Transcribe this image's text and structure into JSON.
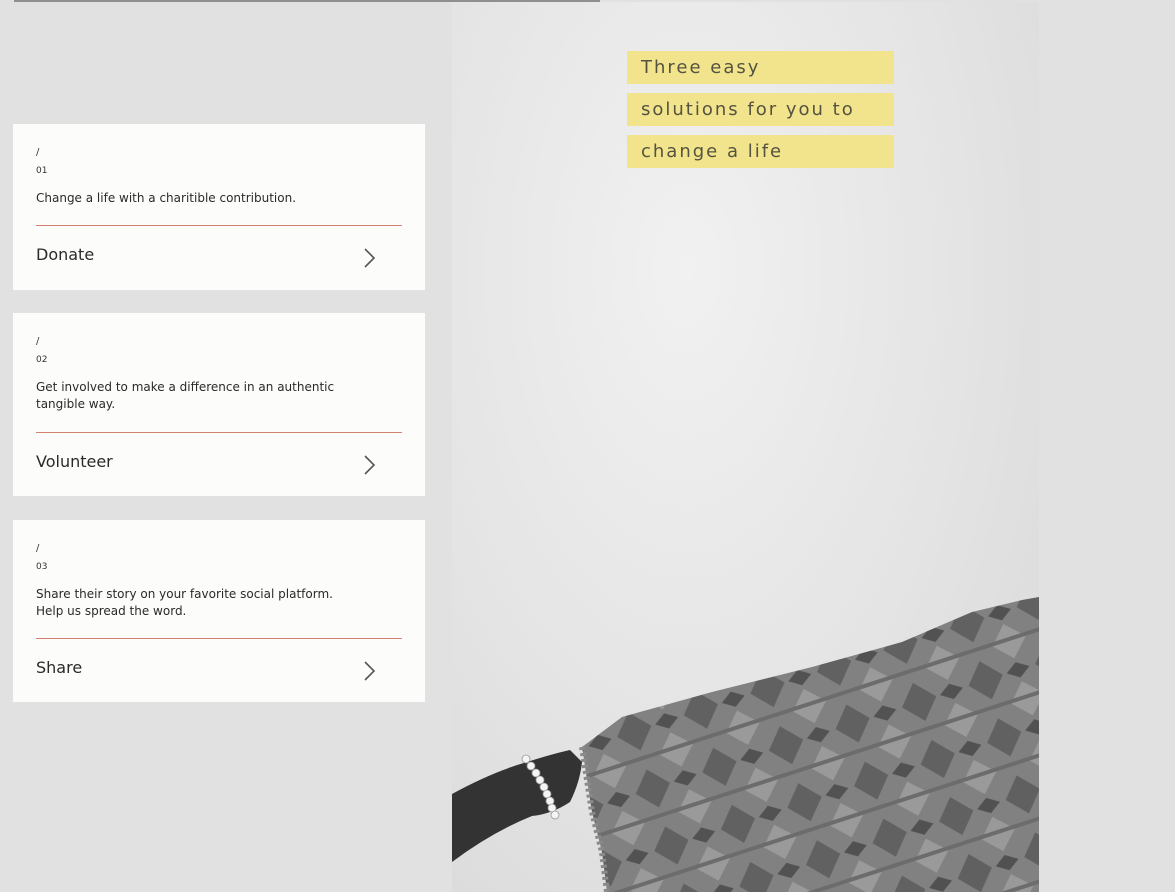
{
  "cards": [
    {
      "slash": "/",
      "number": "01",
      "description": "Change a life with a charitible contribution.",
      "action_label": "Donate",
      "action_icon": "chevron-right-icon"
    },
    {
      "slash": "/",
      "number": "02",
      "description": "Get involved to make a difference in an authentic tangible way.",
      "action_label": "Volunteer",
      "action_icon": "chevron-right-icon"
    },
    {
      "slash": "/",
      "number": "03",
      "description": "Share their story on your favorite social platform. Help us spread the word.",
      "action_label": "Share",
      "action_icon": "chevron-right-icon"
    }
  ],
  "headline": {
    "lines": [
      "Three easy",
      "solutions for you to",
      "change a life"
    ],
    "highlight_color": "#f1e48c"
  },
  "colors": {
    "divider": "#d3826f",
    "card_background": "#fcfcfb",
    "page_background": "#e1e1e2"
  }
}
